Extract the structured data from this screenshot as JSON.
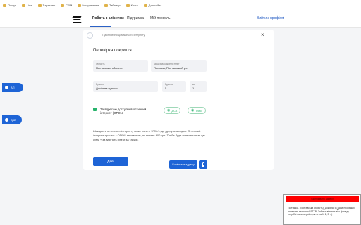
{
  "bookmarks": [
    {
      "icon": "folder-icon",
      "label": "Пошук"
    },
    {
      "icon": "folder-icon",
      "label": "Line"
    },
    {
      "icon": "folder-icon",
      "label": "Ъграклер"
    },
    {
      "icon": "folder-icon",
      "label": "CRM"
    },
    {
      "icon": "folder-icon",
      "label": "Інструменти"
    },
    {
      "icon": "folder-icon",
      "label": "Таблиця"
    },
    {
      "icon": "folder-icon",
      "label": "Крош"
    },
    {
      "icon": "folder-icon",
      "label": "Для сайта"
    }
  ],
  "nav": {
    "items": [
      {
        "label": "Робота з клієнтом",
        "active": true
      },
      {
        "label": "Підтримка",
        "active": false
      },
      {
        "label": "Мій профіль",
        "active": false
      }
    ],
    "logout": "Вийти з профілю"
  },
  "side_buttons": [
    {
      "label": "АП",
      "icon": "chat-icon"
    },
    {
      "label": "ДКВ",
      "icon": "chat-icon"
    }
  ],
  "card": {
    "breadcrumb": "Підключення Домашнього Інтернету",
    "title": "Перевірка покриття",
    "fields": {
      "region": {
        "label": "Область",
        "value": "Полтавська область"
      },
      "locality": {
        "label": "Місцезнаходження пункт",
        "value": "Полтава, Полтавський р-н"
      },
      "street": {
        "label": "Вулиця",
        "value": "Докіаяна вулиця"
      },
      "building": {
        "label": "Будинок",
        "value": "5"
      },
      "apartment": {
        "label": "кв",
        "value": "1"
      }
    },
    "technology": {
      "text": "За адресою доступний оптичний інтернет (GPON)",
      "pill_dsk": "ДСК",
      "pill_tvbi": "ТчКИ"
    },
    "info_text": "Швидкість оптичного інтернету може сягати 1Гбіт/с, це друзуве швидко. Оптичний інтернет працює з ОПОЦ перевагою, ак кажтає 600 грн. Треба буде попвтаться ак цю суму + за вартість плати за тариф.",
    "next_button": "Далі",
    "copy_button": "Копіювати адресу"
  },
  "notice": {
    "header": "Скопійовано адресу",
    "body": "Полтавка. (Полтавська область). Докіяна. 5 (Дана пробежки належить технології FTTB. Зайняті вільних або фасаду потрібні на за версії пунктів на 1, 2, 3, 4)"
  },
  "colors": {
    "accent": "#1e64d6",
    "success": "#27b36b",
    "alert": "#ff0000"
  }
}
